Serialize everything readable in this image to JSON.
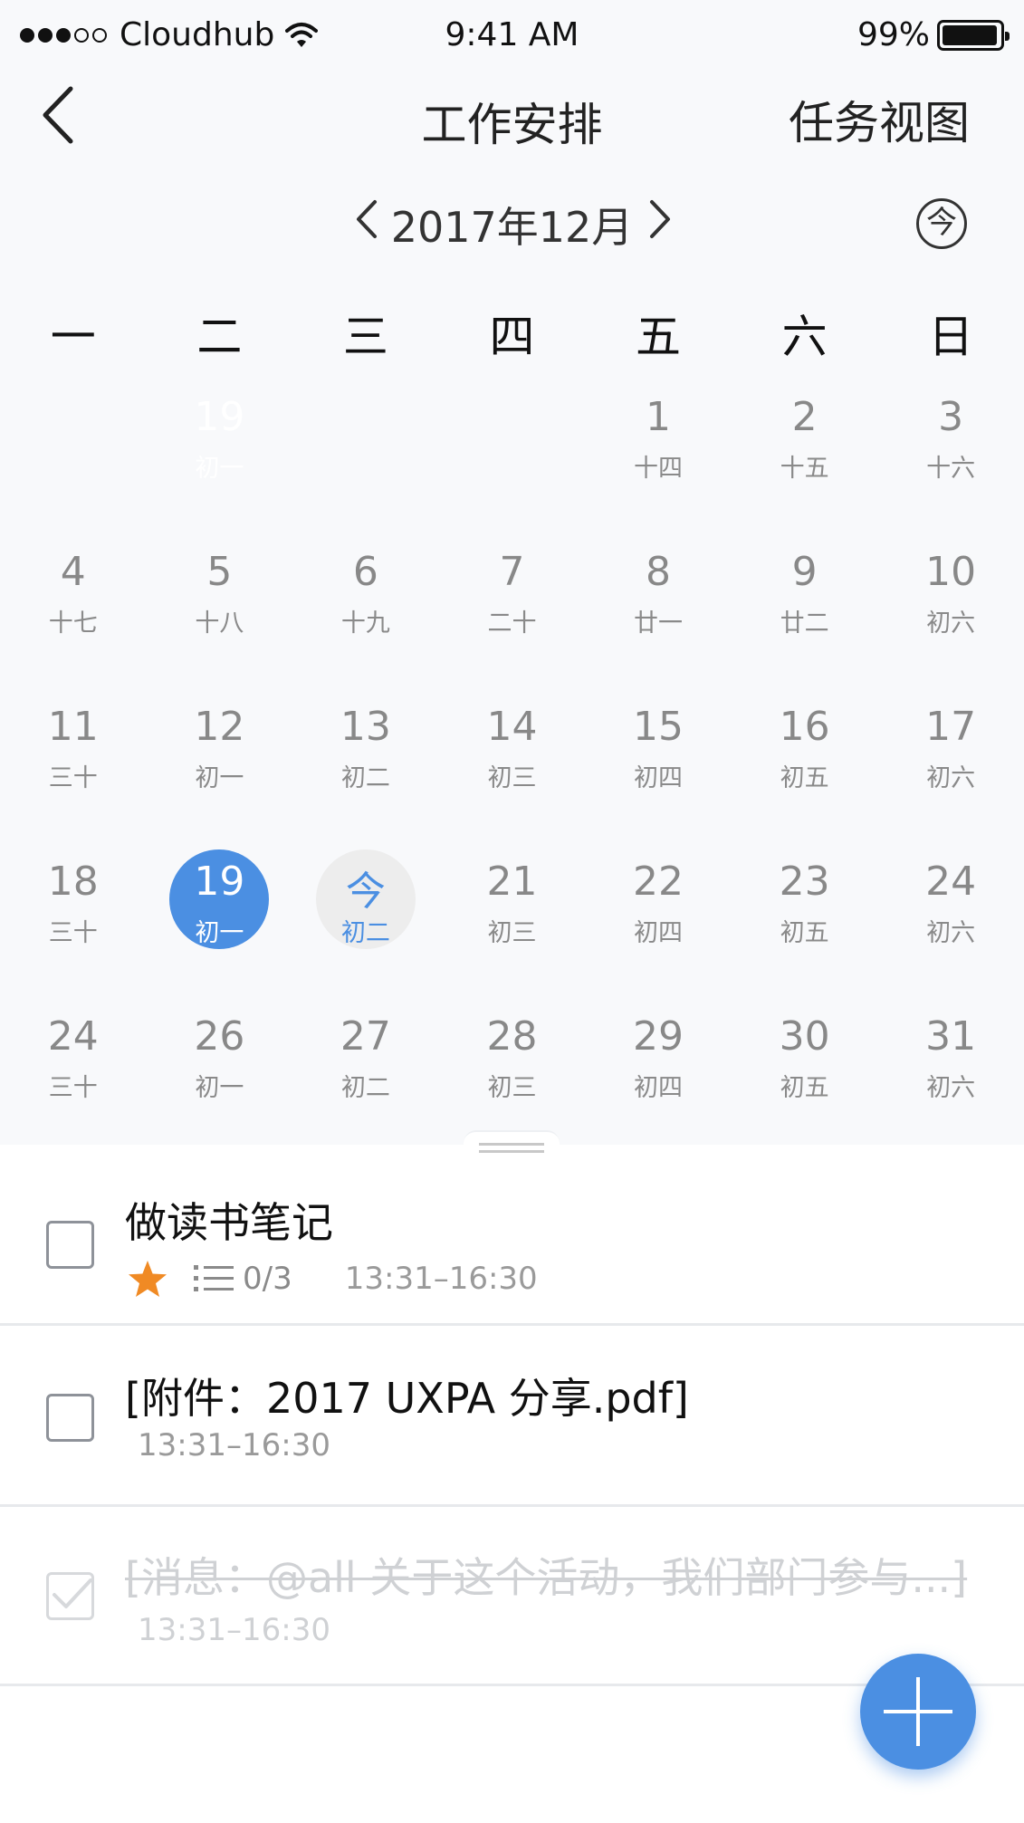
{
  "status_bar": {
    "carrier": "Cloudhub",
    "time": "9:41 AM",
    "battery": "99%"
  },
  "nav": {
    "title": "工作安排",
    "task_view": "任务视图"
  },
  "calendar": {
    "month": "2017年12月",
    "today_label": "今",
    "weekdays": [
      "一",
      "二",
      "三",
      "四",
      "五",
      "六",
      "日"
    ],
    "weeks": [
      [
        {
          "day": "",
          "lunar": ""
        },
        {
          "day": "19",
          "lunar": "初一"
        },
        {
          "day": "",
          "lunar": ""
        },
        {
          "day": "",
          "lunar": ""
        },
        {
          "day": "1",
          "lunar": "十四"
        },
        {
          "day": "2",
          "lunar": "十五"
        },
        {
          "day": "3",
          "lunar": "十六"
        }
      ],
      [
        {
          "day": "4",
          "lunar": "十七"
        },
        {
          "day": "5",
          "lunar": "十八"
        },
        {
          "day": "6",
          "lunar": "十九"
        },
        {
          "day": "7",
          "lunar": "二十"
        },
        {
          "day": "8",
          "lunar": "廿一"
        },
        {
          "day": "9",
          "lunar": "廿二"
        },
        {
          "day": "10",
          "lunar": "初六"
        }
      ],
      [
        {
          "day": "11",
          "lunar": "三十"
        },
        {
          "day": "12",
          "lunar": "初一"
        },
        {
          "day": "13",
          "lunar": "初二"
        },
        {
          "day": "14",
          "lunar": "初三"
        },
        {
          "day": "15",
          "lunar": "初四"
        },
        {
          "day": "16",
          "lunar": "初五"
        },
        {
          "day": "17",
          "lunar": "初六"
        }
      ],
      [
        {
          "day": "18",
          "lunar": "三十"
        },
        {
          "day": "19",
          "lunar": "初一",
          "state": "selected"
        },
        {
          "day": "今",
          "lunar": "初二",
          "state": "today"
        },
        {
          "day": "21",
          "lunar": "初三"
        },
        {
          "day": "22",
          "lunar": "初四"
        },
        {
          "day": "23",
          "lunar": "初五"
        },
        {
          "day": "24",
          "lunar": "初六"
        }
      ],
      [
        {
          "day": "24",
          "lunar": "三十"
        },
        {
          "day": "26",
          "lunar": "初一"
        },
        {
          "day": "27",
          "lunar": "初二"
        },
        {
          "day": "28",
          "lunar": "初三"
        },
        {
          "day": "29",
          "lunar": "初四"
        },
        {
          "day": "30",
          "lunar": "初五"
        },
        {
          "day": "31",
          "lunar": "初六"
        }
      ]
    ]
  },
  "tasks": [
    {
      "title": "做读书笔记",
      "starred": true,
      "subtasks": "0/3",
      "time": "13:31–16:30",
      "done": false
    },
    {
      "title": "[附件：2017 UXPA 分享.pdf]",
      "time": "13:31–16:30",
      "done": false
    },
    {
      "title": "[消息：@all 关于这个活动，我们部门参与...]",
      "time": "13:31–16:30",
      "done": true
    }
  ],
  "colors": {
    "accent": "#4b8fe2",
    "star": "#f08a24",
    "calendar_bg": "#f8f9fb"
  },
  "icons": {
    "back": "chevron-left-icon",
    "month_prev": "chevron-left-icon",
    "month_next": "chevron-right-icon",
    "add": "plus-icon",
    "star": "star-icon",
    "subtask": "list-icon"
  }
}
